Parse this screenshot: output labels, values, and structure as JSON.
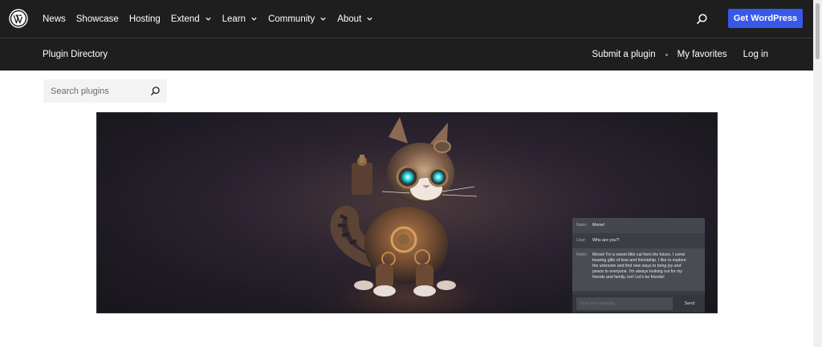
{
  "nav": {
    "logo_icon": "wordpress-logo-icon",
    "items": [
      {
        "label": "News",
        "dropdown": false
      },
      {
        "label": "Showcase",
        "dropdown": false
      },
      {
        "label": "Hosting",
        "dropdown": false
      },
      {
        "label": "Extend",
        "dropdown": true
      },
      {
        "label": "Learn",
        "dropdown": true
      },
      {
        "label": "Community",
        "dropdown": true
      },
      {
        "label": "About",
        "dropdown": true
      }
    ],
    "search_icon": "search-icon",
    "cta_label": "Get WordPress",
    "cta_color": "#3858e9",
    "background": "#1e1e1e"
  },
  "local_nav": {
    "title": "Plugin Directory",
    "links": [
      "Submit a plugin",
      "My favorites",
      "Log in"
    ]
  },
  "search": {
    "placeholder": "Search plugins",
    "icon": "search-icon"
  },
  "banner": {
    "image": "steampunk-robot-cat-illustration",
    "chat": {
      "messages": [
        {
          "who": "Neko:",
          "text": "Meow!"
        },
        {
          "who": "User:",
          "text": "Who are you?!"
        },
        {
          "who": "Neko:",
          "text": "Meow! I'm a sweet little cat from the future. I come bearing gifts of love and friendship. I like to explore the unknown and find new ways to bring joy and peace to everyone. I'm always looking out for my friends and family, too! Let's be friends!"
        }
      ],
      "input_placeholder": "Type your message...",
      "send_label": "Send"
    }
  }
}
